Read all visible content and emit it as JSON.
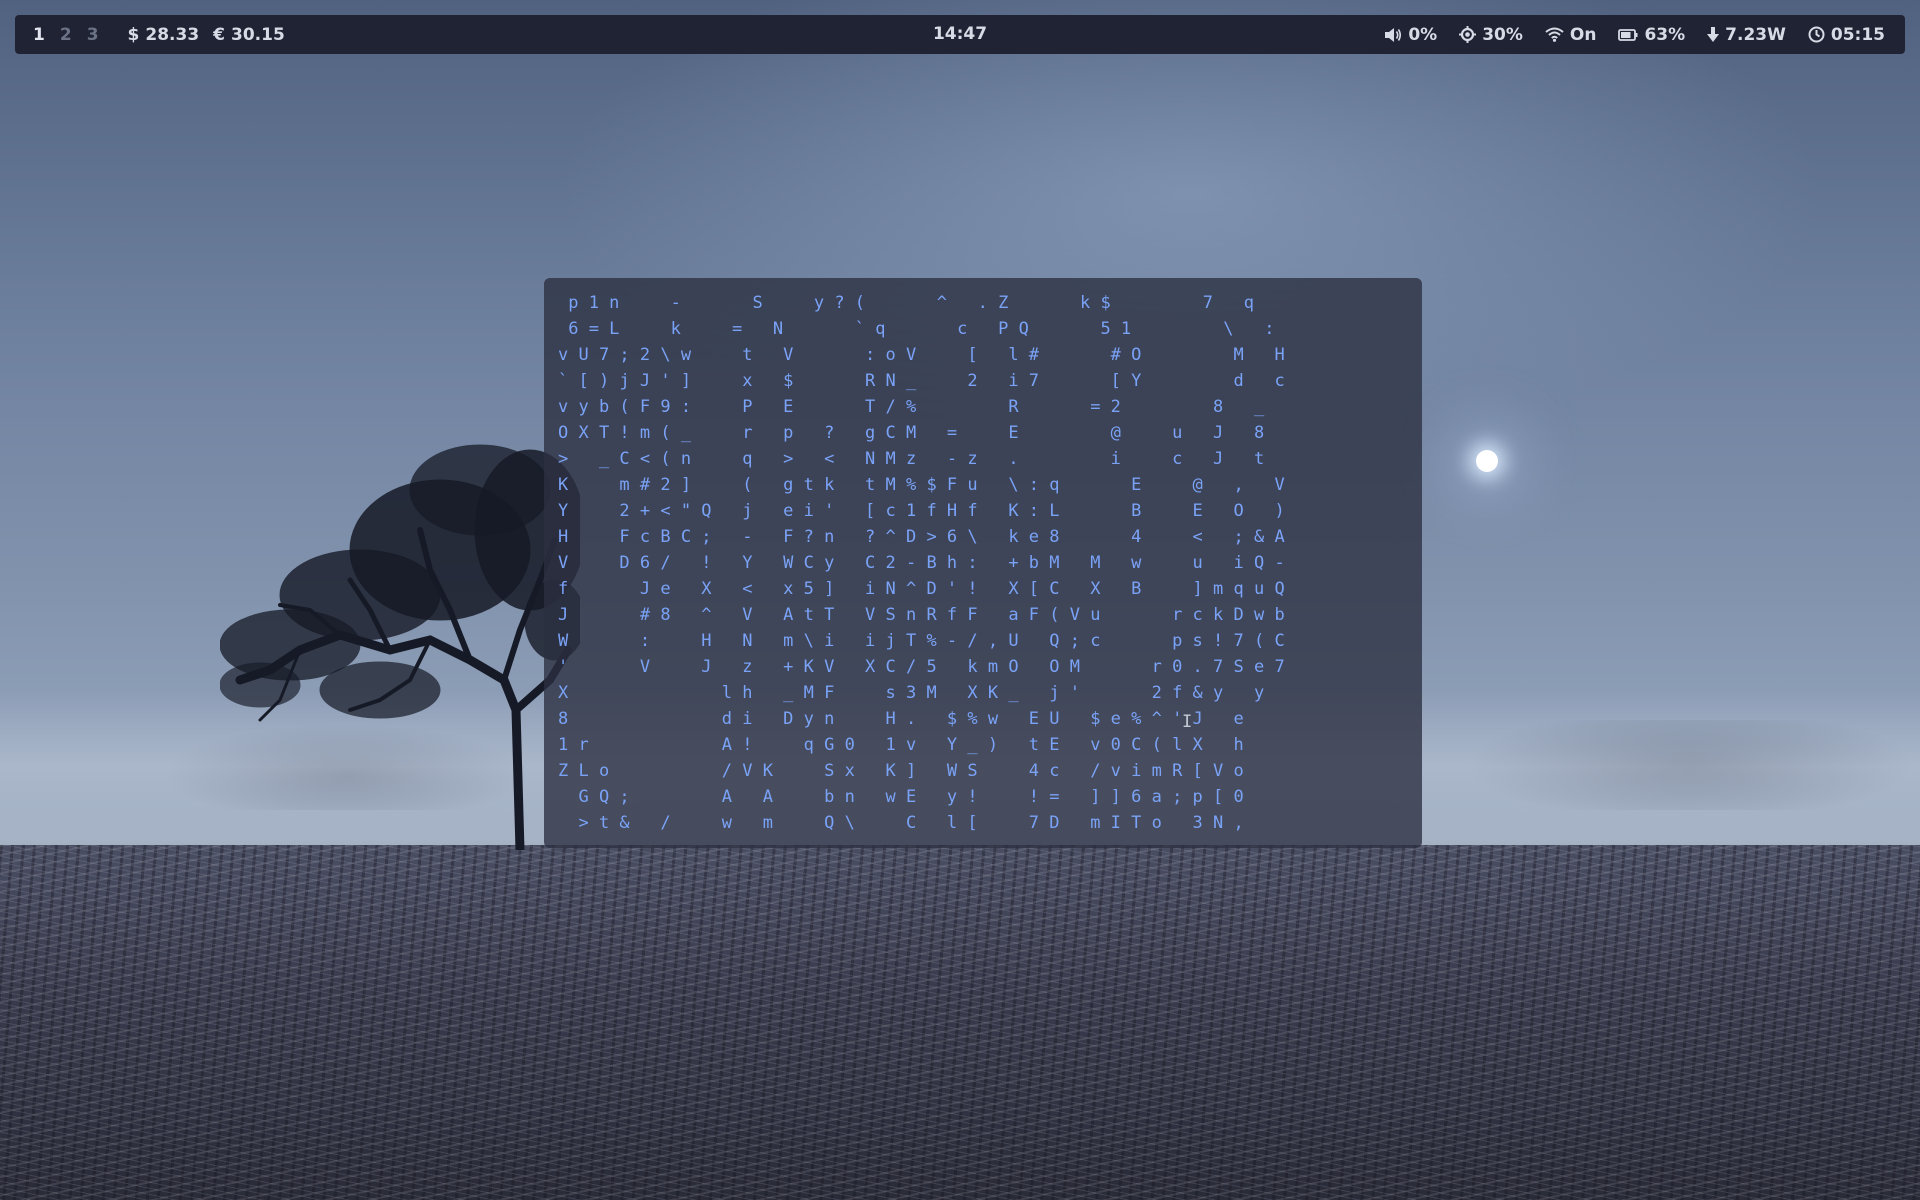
{
  "statusbar": {
    "workspaces": [
      {
        "label": "1",
        "active": true
      },
      {
        "label": "2",
        "active": false
      },
      {
        "label": "3",
        "active": false
      }
    ],
    "ticker_usd": {
      "icon": "dollar-icon",
      "symbol": "$",
      "value": "28.33"
    },
    "ticker_eur": {
      "icon": "euro-icon",
      "symbol": "€",
      "value": "30.15"
    },
    "clock": "14:47",
    "volume": {
      "icon": "speaker-icon",
      "value": "0%"
    },
    "brightness": {
      "icon": "brightness-icon",
      "value": "30%"
    },
    "wifi": {
      "icon": "wifi-icon",
      "value": "On"
    },
    "battery": {
      "icon": "battery-icon",
      "value": "63%"
    },
    "power": {
      "icon": "arrow-down-icon",
      "value": "7.23W"
    },
    "timer": {
      "icon": "clock-icon",
      "value": "05:15"
    }
  },
  "terminal": {
    "lines": [
      " p 1 n     -       S     y ? (       ^   . Z       k $         7   q",
      " 6 = L     k     =   N       ` q       c   P Q       5 1         \\   :",
      "v U 7 ; 2 \\ w     t   V       : o V     [   l #       # O         M   H",
      "` [ ) j J ' ]     x   $       R N _     2   i 7       [ Y         d   c",
      "v y b ( F 9 :     P   E       T / %         R       = 2         8   _",
      "O X T ! m ( _     r   p   ?   g C M   =     E         @     u   J   8",
      ">   _ C < ( n     q   >   <   N M z   - z   .         i     c   J   t",
      "K     m # 2 ]     (   g t k   t M % $ F u   \\ : q       E     @   ,   V",
      "Y     2 + < \" Q   j   e i '   [ c 1 f H f   K : L       B     E   O   )",
      "H     F c B C ;   -   F ? n   ? ^ D > 6 \\   k e 8       4     <   ; & A",
      "V     D 6 /   !   Y   W C y   C 2 - B h :   + b M   M   w     u   i Q -",
      "f       J e   X   <   x 5 ]   i N ^ D ' !   X [ C   X   B     ] m q u Q",
      "J       # 8   ^   V   A t T   V S n R f F   a F ( V u       r c k D w b",
      "W       :     H   N   m \\ i   i j T % - / , U   Q ; c       p s ! 7 ( C",
      "'       V     J   z   + K V   X C / 5   k m O   O M       r 0 . 7 S e 7",
      "X               l h   _ M F     s 3 M   X K _   j '       2 f & y   y",
      "8               d i   D y n     H .   $ % w   E U   $ e % ^ ' J   e",
      "1 r             A !     q G 0   1 v   Y _ )   t E   v 0 C ( l X   h",
      "Z L o           / V K     S x   K ]   W S     4 c   / v i m R [ V o",
      "  G Q ;         A   A     b n   w E   y !     ! =   ] ] 6 a ; p [ 0",
      "  > t &   /     w   m     Q \\     C   l [     7 D   m I T o   3 N ,"
    ]
  }
}
